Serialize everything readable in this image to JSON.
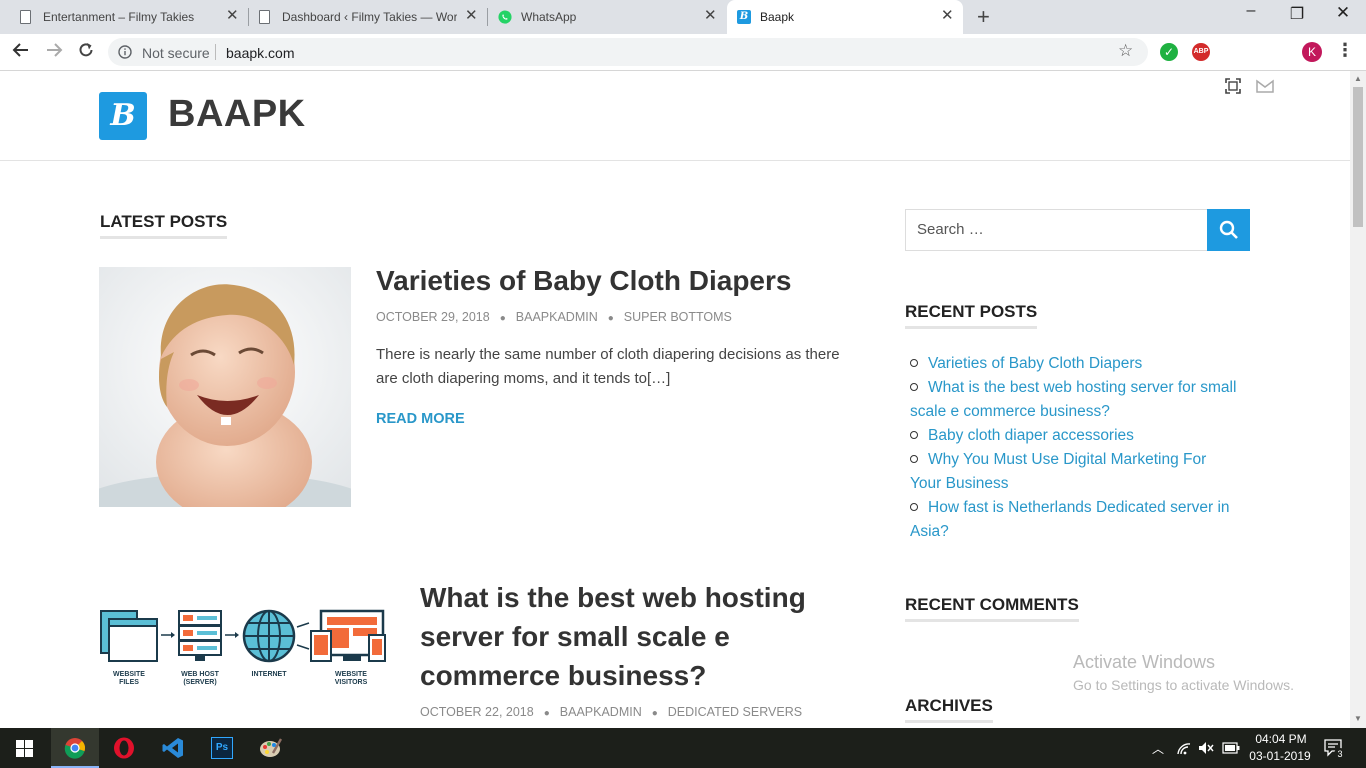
{
  "browser": {
    "tabs": [
      {
        "title": "Entertanment – Filmy Takies",
        "icon": "page-icon"
      },
      {
        "title": "Dashboard ‹ Filmy Takies — Wor",
        "icon": "page-icon"
      },
      {
        "title": "WhatsApp",
        "icon": "whatsapp-icon"
      },
      {
        "title": "Baapk",
        "icon": "baapk-favicon",
        "active": true
      }
    ],
    "security_label": "Not secure",
    "url": "baapk.com",
    "profile_initial": "K",
    "abp_label": "ABP"
  },
  "site": {
    "logo_letter": "B",
    "title": "BAAPK"
  },
  "main": {
    "latest_heading": "LATEST POSTS",
    "posts": [
      {
        "title": "Varieties of Baby Cloth Diapers",
        "date": "OCTOBER 29, 2018",
        "author": "BAAPKADMIN",
        "category": "SUPER BOTTOMS",
        "excerpt": "There is nearly the same number of cloth diapering decisions as there are cloth diapering moms, and it tends to[…]",
        "read_more": "READ MORE"
      },
      {
        "title": "What is the best web hosting server for small scale e commerce business?",
        "date": "OCTOBER 22, 2018",
        "author": "BAAPKADMIN",
        "category": "DEDICATED SERVERS",
        "diagram_labels": [
          "WEBSITE FILES",
          "WEB HOST (SERVER)",
          "INTERNET",
          "WEBSITE VISITORS"
        ]
      }
    ]
  },
  "sidebar": {
    "search_placeholder": "Search …",
    "recent_posts_heading": "RECENT POSTS",
    "recent_posts": [
      "Varieties of Baby Cloth Diapers",
      "What is the best web hosting server for small scale e commerce business?",
      "Baby cloth diaper accessories",
      "Why You Must Use Digital Marketing For Your Business",
      "How fast is Netherlands Dedicated server in Asia?"
    ],
    "recent_comments_heading": "RECENT COMMENTS",
    "archives_heading": "ARCHIVES"
  },
  "watermark": {
    "title": "Activate Windows",
    "subtitle": "Go to Settings to activate Windows."
  },
  "taskbar": {
    "apps": [
      "windows-start-icon",
      "chrome-icon",
      "opera-icon",
      "vscode-icon",
      "photoshop-icon",
      "paint-icon"
    ],
    "time": "04:04 PM",
    "date": "03-01-2019",
    "notification_count": "3"
  },
  "colors": {
    "accent": "#1e9ae0",
    "link": "#2997c9"
  }
}
